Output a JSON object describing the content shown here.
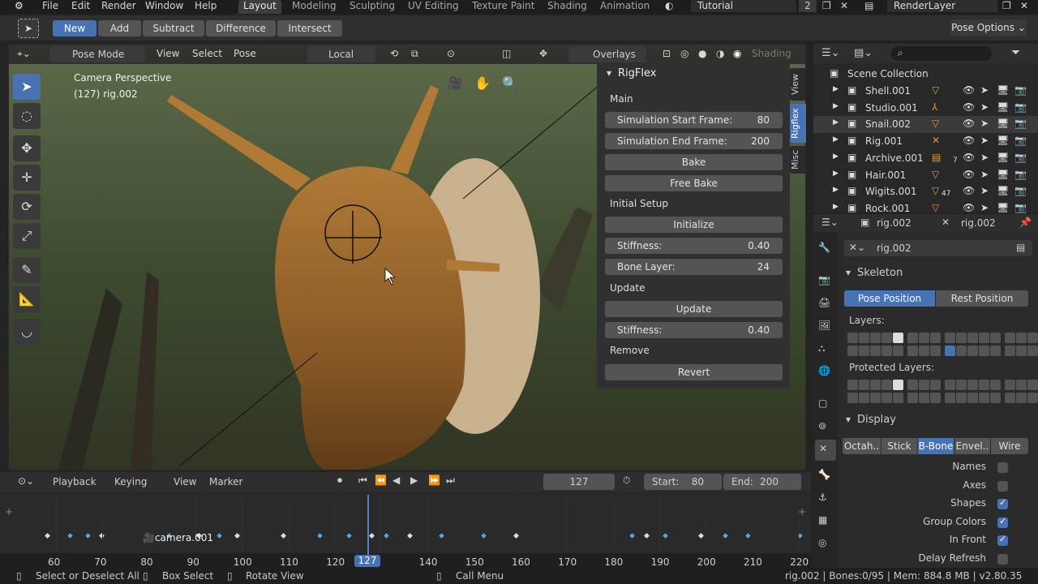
{
  "topbar": {
    "menus": [
      "File",
      "Edit",
      "Render",
      "Window",
      "Help"
    ],
    "workspaces": [
      "Layout",
      "Modeling",
      "Sculpting",
      "UV Editing",
      "Texture Paint",
      "Shading",
      "Animation"
    ],
    "active_workspace": "Layout",
    "scene_name": "Tutorial",
    "scene_count": "2",
    "view_layer": "RenderLayer"
  },
  "toolsettings": {
    "modes": [
      "New",
      "Add",
      "Subtract",
      "Difference",
      "Intersect"
    ],
    "active_mode": "New",
    "pose_options": "Pose Options"
  },
  "viewport": {
    "mode": "Pose Mode",
    "menus": [
      "View",
      "Select",
      "Pose"
    ],
    "orientation": "Local",
    "overlays": "Overlays",
    "shading": "Shading",
    "info_line1": "Camera Perspective",
    "info_line2": "(127) rig.002"
  },
  "npanel": {
    "title": "RigFlex",
    "tabs": [
      "View",
      "Rigflex",
      "Misc"
    ],
    "active_tab": "Rigflex",
    "main_label": "Main",
    "sim_start_label": "Simulation Start Frame:",
    "sim_start_value": "80",
    "sim_end_label": "Simulation End Frame:",
    "sim_end_value": "200",
    "bake": "Bake",
    "free_bake": "Free Bake",
    "initial_setup_label": "Initial Setup",
    "initialize": "Initialize",
    "stiffness_label": "Stiffness:",
    "stiffness_value": "0.40",
    "bone_layer_label": "Bone Layer:",
    "bone_layer_value": "24",
    "update_label": "Update",
    "update": "Update",
    "stiffness2_label": "Stiffness:",
    "stiffness2_value": "0.40",
    "remove_label": "Remove",
    "revert": "Revert"
  },
  "outliner": {
    "root": "Scene Collection",
    "items": [
      "Shell.001",
      "Studio.001",
      "Snail.002",
      "Rig.001",
      "Archive.001",
      "Hair.001",
      "Wigits.001",
      "Rock.001"
    ],
    "badge_archive": "7",
    "badge_wigits": "47"
  },
  "props": {
    "object_name": "rig.002",
    "data_name": "rig.002",
    "datablock": "rig.002",
    "skeleton_label": "Skeleton",
    "pose_position": "Pose Position",
    "rest_position": "Rest Position",
    "layers_label": "Layers:",
    "protected_layers_label": "Protected Layers:",
    "display_label": "Display",
    "display_types": [
      "Octah..",
      "Stick",
      "B-Bone",
      "Envel..",
      "Wire"
    ],
    "active_display": "B-Bone",
    "options": [
      {
        "label": "Names",
        "checked": false
      },
      {
        "label": "Axes",
        "checked": false
      },
      {
        "label": "Shapes",
        "checked": true
      },
      {
        "label": "Group Colors",
        "checked": true
      },
      {
        "label": "In Front",
        "checked": true
      },
      {
        "label": "Delay Refresh",
        "checked": false
      }
    ]
  },
  "timeline": {
    "menus": [
      "Playback",
      "Keying",
      "View",
      "Marker"
    ],
    "current_frame": "127",
    "start_label": "Start:",
    "start_value": "80",
    "end_label": "End:",
    "end_value": "200",
    "marker_name": "camera.001",
    "ticks": [
      "60",
      "70",
      "80",
      "90",
      "100",
      "110",
      "120",
      "127",
      "140",
      "150",
      "160",
      "170",
      "180",
      "190",
      "200",
      "210",
      "220"
    ]
  },
  "status": {
    "select": "Select or Deselect All",
    "box": "Box Select",
    "rotate": "Rotate View",
    "call_menu": "Call Menu",
    "stats": "rig.002 | Bones:0/95 | Mem: 884.8 MB | v2.80.35"
  },
  "colors": {
    "accent": "#4772b3",
    "playhead": "#5680c2",
    "snail": "#a06a2e",
    "shell": "#c9b18e",
    "forest": "#4a5a3a"
  }
}
